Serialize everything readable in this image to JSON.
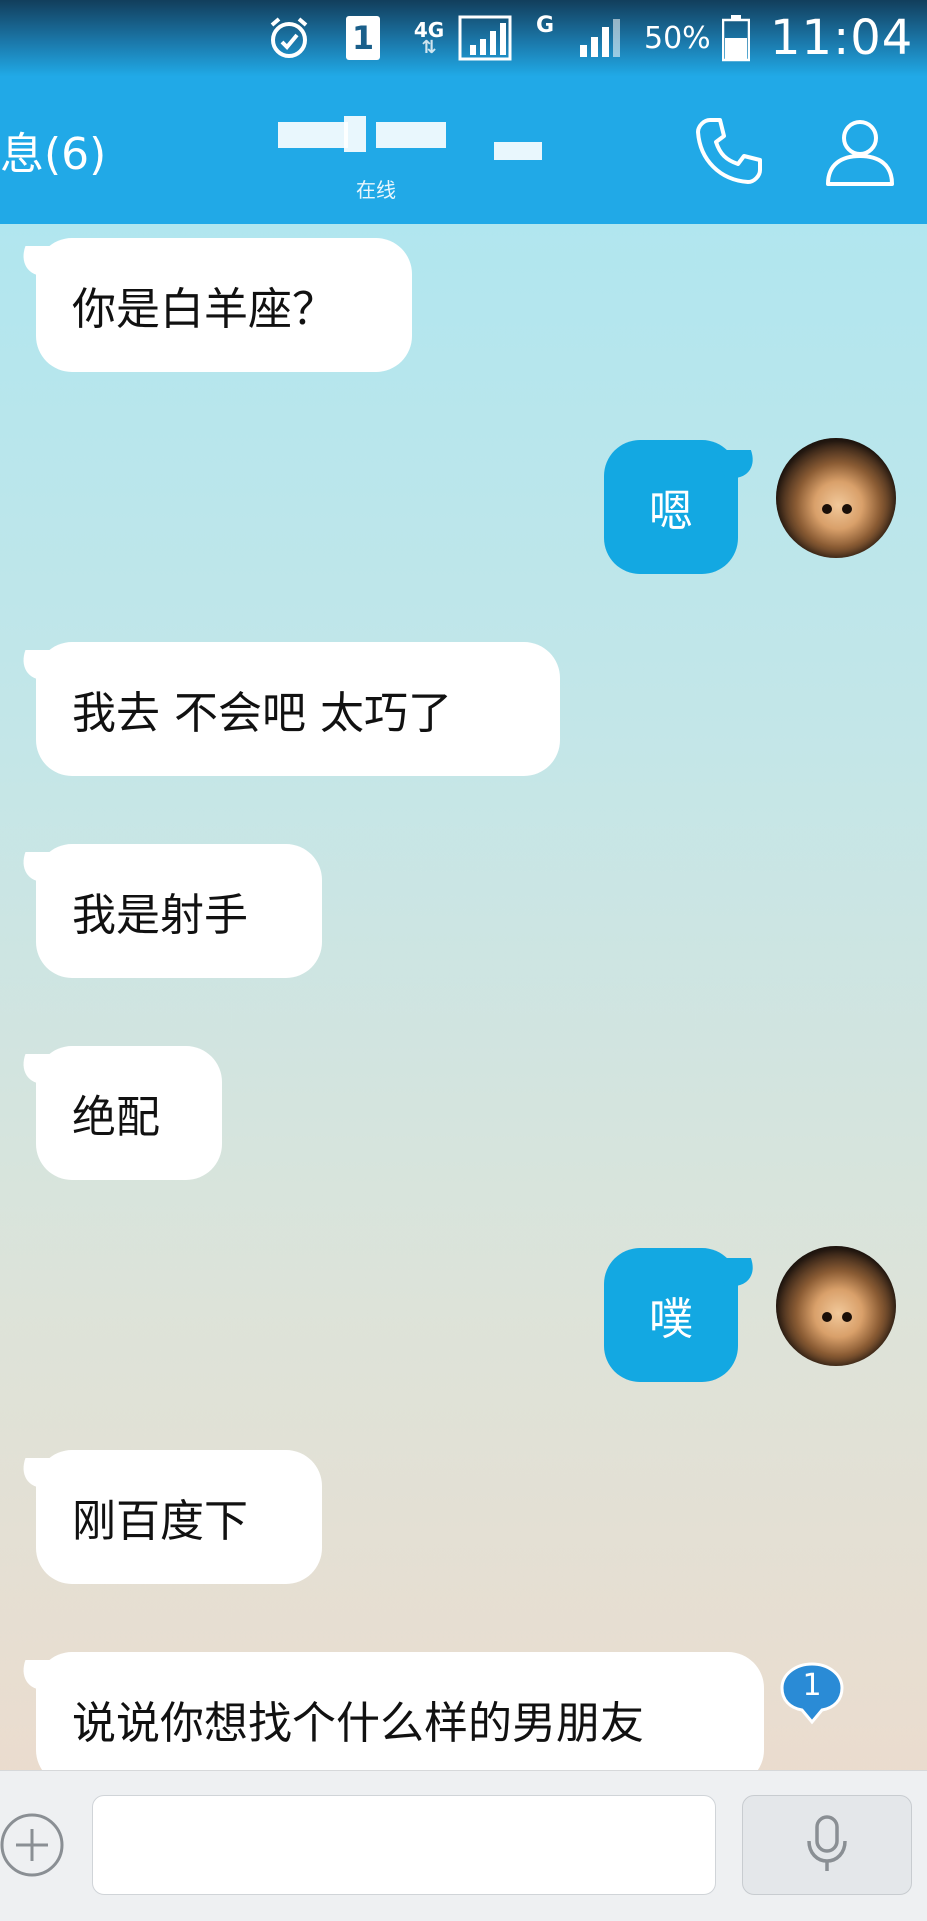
{
  "status_bar": {
    "sim_slot": "1",
    "network_type": "4G",
    "second_network": "G",
    "battery_percent": "50%",
    "time": "11:04",
    "icons": [
      "alarm-clock-icon",
      "sim-icon",
      "signal-icon",
      "signal-icon",
      "battery-icon"
    ]
  },
  "header": {
    "back_label": "息(6)",
    "contact_status": "在线",
    "call_icon": "phone-icon",
    "profile_icon": "contact-icon"
  },
  "messages": [
    {
      "side": "left",
      "text": "你是白羊座？"
    },
    {
      "side": "right",
      "text": "嗯"
    },
    {
      "side": "left",
      "text": "我去  不会吧 太巧了"
    },
    {
      "side": "left",
      "text": "我是射手"
    },
    {
      "side": "left",
      "text": "绝配"
    },
    {
      "side": "right",
      "text": "噗"
    },
    {
      "side": "left",
      "text": "刚百度下"
    },
    {
      "side": "left",
      "text": "说说你想找个什么样的男朋友"
    }
  ],
  "unread_badge": "1",
  "input_bar": {
    "text_value": "",
    "plus_icon": "plus-circle-icon",
    "voice_icon": "microphone-icon"
  },
  "colors": {
    "header_blue": "#21a9e7",
    "outgoing_bubble": "#13a8e2",
    "incoming_bubble": "#ffffff"
  }
}
